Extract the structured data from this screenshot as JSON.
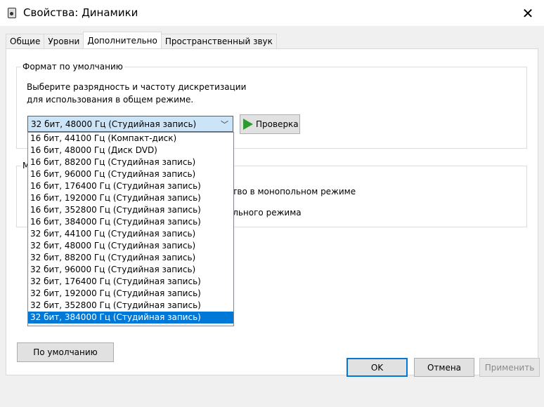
{
  "window": {
    "title": "Свойства: Динамики",
    "close_glyph": "✕"
  },
  "tabs": [
    {
      "label": "Общие",
      "active": false
    },
    {
      "label": "Уровни",
      "active": false
    },
    {
      "label": "Дополнительно",
      "active": true
    },
    {
      "label": "Пространственный звук",
      "active": false
    }
  ],
  "default_format": {
    "group_title": "Формат по умолчанию",
    "description": "Выберите разрядность и частоту дискретизации для использования в общем режиме.",
    "selected_value": "32 бит, 48000 Гц (Студийная запись)",
    "test_button": "Проверка",
    "options": [
      "16 бит, 44100 Гц (Компакт-диск)",
      "16 бит, 48000 Гц (Диск DVD)",
      "16 бит, 88200 Гц (Студийная запись)",
      "16 бит, 96000 Гц (Студийная запись)",
      "16 бит, 176400 Гц (Студийная запись)",
      "16 бит, 192000 Гц (Студийная запись)",
      "16 бит, 352800 Гц (Студийная запись)",
      "16 бит, 384000 Гц (Студийная запись)",
      "32 бит, 44100 Гц (Студийная запись)",
      "32 бит, 48000 Гц (Студийная запись)",
      "32 бит, 88200 Гц (Студийная запись)",
      "32 бит, 96000 Гц (Студийная запись)",
      "32 бит, 176400 Гц (Студийная запись)",
      "32 бит, 192000 Гц (Студийная запись)",
      "32 бит, 352800 Гц (Студийная запись)",
      "32 бит, 384000 Гц (Студийная запись)"
    ],
    "highlighted_option": "32 бит, 384000 Гц (Студийная запись)"
  },
  "exclusive_mode": {
    "group_title_partial": "М",
    "option1_partial": "йство в монопольном режиме",
    "option2_partial": "польного режима"
  },
  "buttons": {
    "restore_defaults": "По умолчанию",
    "ok": "OK",
    "cancel": "Отмена",
    "apply": "Применить"
  },
  "colors": {
    "accent": "#0078d7",
    "play": "#2e9b2e"
  }
}
